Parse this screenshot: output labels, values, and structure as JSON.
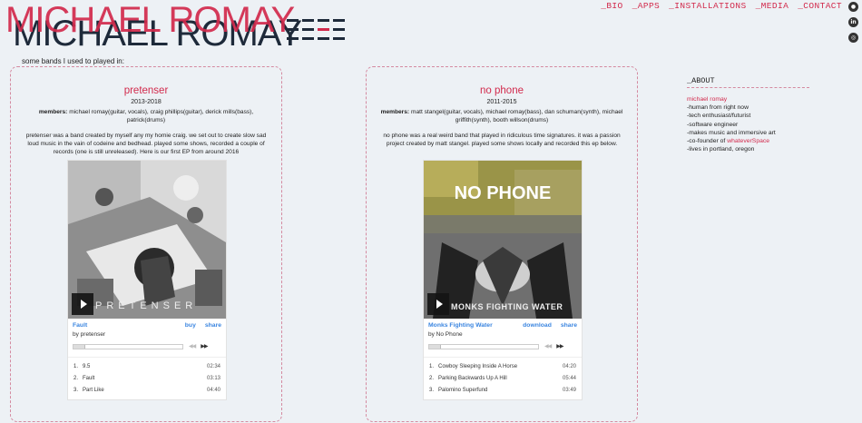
{
  "header": {
    "logo_text": "MICHAEL ROMAY",
    "nav": [
      "_BIO",
      "_APPS",
      "_INSTALLATIONS",
      "_MEDIA",
      "_CONTACT"
    ],
    "social": [
      "github-icon",
      "linkedin-icon",
      "instagram-icon"
    ]
  },
  "intro": "some bands I used to played in:",
  "bands": [
    {
      "name": "pretenser",
      "years": "2013-2018",
      "members_label": "members:",
      "members": "michael romay(guitar, vocals), craig phillips(guitar), derick mills(bass), patrick(drums)",
      "description": "pretenser was a band created by myself any my homie craig. we set out to create slow sad loud music in the vain of codeine and bedhead. played some shows, recorded a couple of records (one is still unreleased). Here is our first EP from around 2016",
      "player": {
        "cover_text": "PRETENSER",
        "track_title": "Fault",
        "actions": [
          "buy",
          "share"
        ],
        "by": "by pretenser",
        "tracks": [
          {
            "n": "1.",
            "title": "9.5",
            "time": "02:34"
          },
          {
            "n": "2.",
            "title": "Fault",
            "time": "03:13"
          },
          {
            "n": "3.",
            "title": "Part Like",
            "time": "04:40"
          }
        ]
      }
    },
    {
      "name": "no phone",
      "years": "2011-2015",
      "members_label": "members:",
      "members": "matt stangel(guitar, vocals), michael romay(bass), dan schuman(synth), michael griffith(synth), booth willson(drums)",
      "description": "no phone was a real weird band that played in ridiculous time signatures. it was a passion project created by matt stangel. played some shows locally and recorded this ep below.",
      "player": {
        "cover_title": "NO PHONE",
        "cover_text": "MONKS FIGHTING WATER",
        "track_title": "Monks Fighting Water",
        "actions": [
          "download",
          "share"
        ],
        "by": "by No Phone",
        "tracks": [
          {
            "n": "1.",
            "title": "Cowboy Sleeping Inside A Horse",
            "time": "04:20"
          },
          {
            "n": "2.",
            "title": "Parking Backwards Up A Hill",
            "time": "05:44"
          },
          {
            "n": "3.",
            "title": "Palomino Superfund",
            "time": "03:49"
          }
        ]
      }
    }
  ],
  "about": {
    "title": "_ABOUT",
    "name": "michael romay",
    "lines": [
      "-human from right now",
      "-tech enthusiast/futurist",
      "-software engineer",
      "-makes music and immersive art"
    ],
    "cofounder_prefix": "-co-founder of ",
    "cofounder_link": "whateverSpace",
    "last_line": "-lives in portland, oregon"
  },
  "colors": {
    "accent": "#d22a4c",
    "link": "#3a85e0",
    "background": "#edf1f5"
  }
}
